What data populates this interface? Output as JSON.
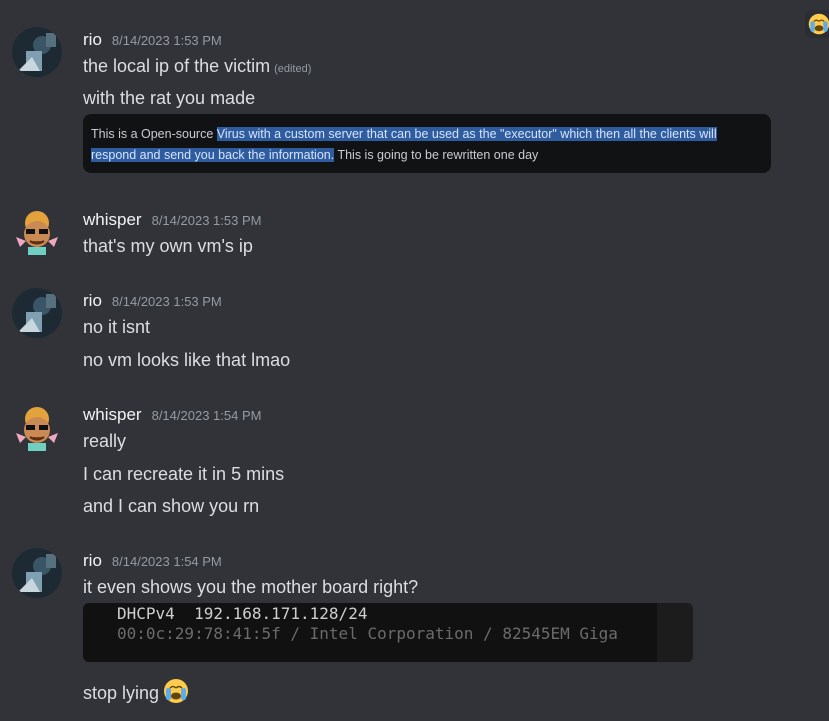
{
  "messages": [
    {
      "username": "rio",
      "timestamp": "8/14/2023 1:53 PM",
      "lines": [
        "the local ip of the victim",
        "with the rat you made"
      ],
      "edited": "(edited)",
      "quote": {
        "before": "This is a Open-source ",
        "selected": "Virus with a custom server that can be used as the \"executor\" which then all the clients will respond and send you back the information.",
        "after": " This is going to be rewritten one day"
      }
    },
    {
      "username": "whisper",
      "timestamp": "8/14/2023 1:53 PM",
      "lines": [
        "that's my own vm's ip"
      ]
    },
    {
      "username": "rio",
      "timestamp": "8/14/2023 1:53 PM",
      "lines": [
        "no it isnt",
        "no vm looks like that lmao"
      ]
    },
    {
      "username": "whisper",
      "timestamp": "8/14/2023 1:54 PM",
      "lines": [
        "really",
        "I can recreate it in 5 mins",
        "and I can show you rn"
      ]
    },
    {
      "username": "rio",
      "timestamp": "8/14/2023 1:54 PM",
      "lines": [
        "it even shows you the mother board right?",
        "stop lying"
      ],
      "terminal": [
        "DHCPv4  192.168.171.128/24",
        "00:0c:29:78:41:5f / Intel Corporation / 82545EM Giga"
      ]
    }
  ],
  "emoji": {
    "loudly_crying": "loudly-crying-face"
  }
}
